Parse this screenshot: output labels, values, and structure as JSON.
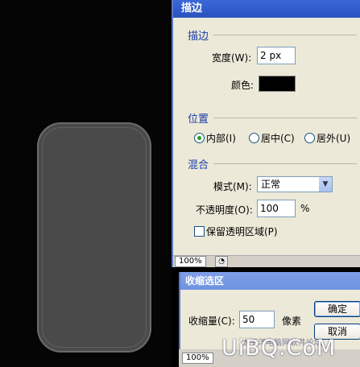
{
  "stroke_dialog": {
    "title": "描边",
    "stroke_group": "描边",
    "width_label": "宽度(W):",
    "width_value": "2 px",
    "color_label": "颜色:",
    "color_value": "#000000",
    "position_group": "位置",
    "position_options": [
      "内部(I)",
      "居中(C)",
      "居外(U)"
    ],
    "position_selected": 0,
    "blend_group": "混合",
    "mode_label": "模式(M):",
    "mode_value": "正常",
    "opacity_label": "不透明度(O):",
    "opacity_value": "100",
    "opacity_unit": "%",
    "preserve_label": "保留透明区域(P)",
    "zoom": "100%"
  },
  "contract_dialog": {
    "title": "收缩选区",
    "amount_label": "收缩量(C):",
    "amount_value": "50",
    "amount_unit": "像素",
    "ok_label": "确定",
    "cancel_label": "取消",
    "zoom": "100%"
  },
  "watermark": {
    "text": "UiBQ.CoM",
    "sub": "太平洋电脑网软件论坛"
  },
  "colors": {
    "canvas_bg": "#050505",
    "shape_fill": "#4a4a4a",
    "dialog_bg": "#ece9d8",
    "titlebar": "#2a52c0"
  }
}
